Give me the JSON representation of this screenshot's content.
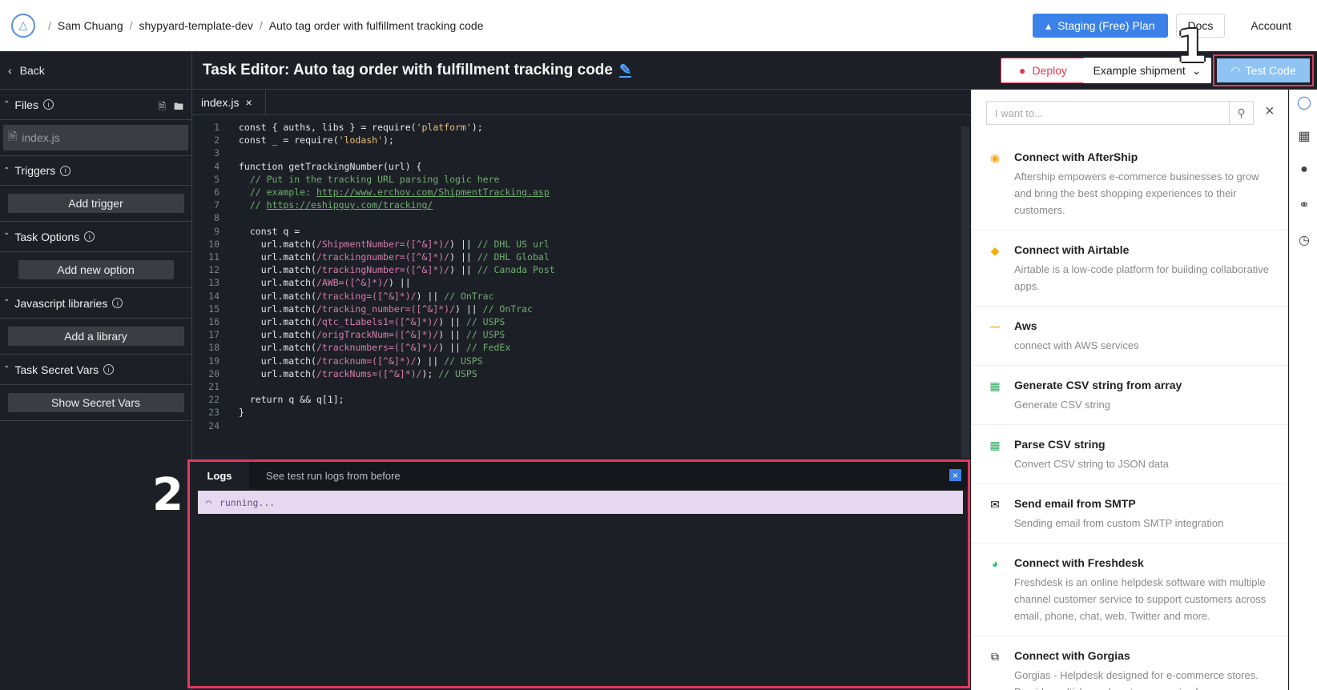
{
  "breadcrumb": {
    "user": "Sam Chuang",
    "project": "shypyard-template-dev",
    "task": "Auto tag order with fulfillment tracking code"
  },
  "top": {
    "plan_label": "Staging (Free) Plan",
    "docs_label": "Docs",
    "account_label": "Account"
  },
  "sidebar": {
    "back_label": "Back",
    "files_label": "Files",
    "file_name": "index.js",
    "triggers_label": "Triggers",
    "add_trigger": "Add trigger",
    "task_options_label": "Task Options",
    "add_option": "Add new option",
    "libraries_label": "Javascript libraries",
    "add_library": "Add a library",
    "secret_vars_label": "Task Secret Vars",
    "show_secret": "Show Secret Vars"
  },
  "editor": {
    "title": "Task Editor: Auto tag order with fulfillment tracking code",
    "deploy_label": "Deploy",
    "example_label": "Example shipment",
    "test_label": "Test Code",
    "tab_name": "index.js"
  },
  "code_lines": [
    {
      "n": "1",
      "html": "const { auths, libs } = require(<span class=\"str\">'platform'</span>);"
    },
    {
      "n": "2",
      "html": "const _ = require(<span class=\"str\">'lodash'</span>);"
    },
    {
      "n": "3",
      "html": ""
    },
    {
      "n": "4",
      "html": "function getTrackingNumber(url) {"
    },
    {
      "n": "5",
      "html": "  <span class=\"cm\">// Put in the tracking URL parsing logic here</span>"
    },
    {
      "n": "6",
      "html": "  <span class=\"cm\">// example: </span><span class=\"lk\">http://www.erchov.com/ShipmentTracking.asp</span>"
    },
    {
      "n": "7",
      "html": "  <span class=\"cm\">// </span><span class=\"lk\">https://eshipguy.com/tracking/</span>"
    },
    {
      "n": "8",
      "html": ""
    },
    {
      "n": "9",
      "html": "  const q ="
    },
    {
      "n": "10",
      "html": "    url.match(<span class=\"rx\">/ShipmentNumber=([^&amp;]*)/</span>) || <span class=\"cm\">// DHL US url</span>"
    },
    {
      "n": "11",
      "html": "    url.match(<span class=\"rx\">/trackingnumber=([^&amp;]*)/</span>) || <span class=\"cm\">// DHL Global</span>"
    },
    {
      "n": "12",
      "html": "    url.match(<span class=\"rx\">/trackingNumber=([^&amp;]*)/</span>) || <span class=\"cm\">// Canada Post</span>"
    },
    {
      "n": "13",
      "html": "    url.match(<span class=\"rx\">/AWB=([^&amp;]*)/</span>) ||"
    },
    {
      "n": "14",
      "html": "    url.match(<span class=\"rx\">/tracking=([^&amp;]*)/</span>) || <span class=\"cm\">// OnTrac</span>"
    },
    {
      "n": "15",
      "html": "    url.match(<span class=\"rx\">/tracking_number=([^&amp;]*)/</span>) || <span class=\"cm\">// OnTrac</span>"
    },
    {
      "n": "16",
      "html": "    url.match(<span class=\"rx\">/qtc_tLabels1=([^&amp;]*)/</span>) || <span class=\"cm\">// USPS</span>"
    },
    {
      "n": "17",
      "html": "    url.match(<span class=\"rx\">/origTrackNum=([^&amp;]*)/</span>) || <span class=\"cm\">// USPS</span>"
    },
    {
      "n": "18",
      "html": "    url.match(<span class=\"rx\">/tracknumbers=([^&amp;]*)/</span>) || <span class=\"cm\">// FedEx</span>"
    },
    {
      "n": "19",
      "html": "    url.match(<span class=\"rx\">/tracknum=([^&amp;]*)/</span>) || <span class=\"cm\">// USPS</span>"
    },
    {
      "n": "20",
      "html": "    url.match(<span class=\"rx\">/trackNums=([^&amp;]*)/</span>); <span class=\"cm\">// USPS</span>"
    },
    {
      "n": "21",
      "html": ""
    },
    {
      "n": "22",
      "html": "  return q &amp;&amp; q[1];"
    },
    {
      "n": "23",
      "html": "}"
    },
    {
      "n": "24",
      "html": ""
    }
  ],
  "logs": {
    "tab_logs": "Logs",
    "tab_history": "See test run logs from before",
    "running_text": "running..."
  },
  "right_panel": {
    "search_placeholder": "I want to...",
    "items": [
      {
        "title": "Connect with AfterShip",
        "desc": "Aftership empowers e-commerce businesses to grow and bring the best shopping experiences to their customers.",
        "icon": "aftership-icon",
        "color": "#f5a623"
      },
      {
        "title": "Connect with Airtable",
        "desc": "Airtable is a low-code platform for building collaborative apps.",
        "icon": "airtable-icon",
        "color": "#f0b400"
      },
      {
        "title": "Aws",
        "desc": "connect with AWS services",
        "icon": "aws-icon",
        "color": "#f90"
      },
      {
        "title": "Generate CSV string from array",
        "desc": "Generate CSV string",
        "icon": "spreadsheet-icon",
        "color": "#2fae60"
      },
      {
        "title": "Parse CSV string",
        "desc": "Convert CSV string to JSON data",
        "icon": "spreadsheet-icon",
        "color": "#2fae60"
      },
      {
        "title": "Send email from SMTP",
        "desc": "Sending email from custom SMTP integration",
        "icon": "email-icon",
        "color": "#111111"
      },
      {
        "title": "Connect with Freshdesk",
        "desc": "Freshdesk is an online helpdesk software with multiple channel customer service to support customers across email, phone, chat, web, Twitter and more.",
        "icon": "headset-icon",
        "color": "#25c16f"
      },
      {
        "title": "Connect with Gorgias",
        "desc": "Gorgias - Helpdesk designed for e-commerce stores. Provide multichannel customer service from a",
        "icon": "gorgias-icon",
        "color": "#222222"
      }
    ]
  },
  "annotations": {
    "marker_1": "1",
    "marker_2": "2"
  }
}
